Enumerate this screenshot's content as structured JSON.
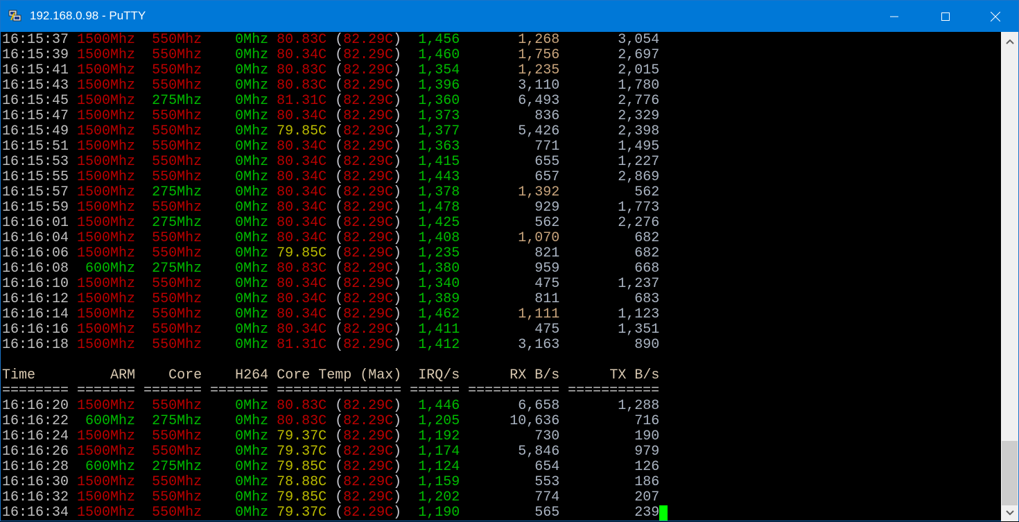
{
  "window": {
    "title": "192.168.0.98 - PuTTY"
  },
  "colors": {
    "titlebar": "#0078d7",
    "cursor": "#00ff00"
  },
  "header": [
    "Time",
    "ARM",
    "Core",
    "H264",
    "Core Temp (Max)",
    "IRQ/s",
    "RX B/s",
    "TX B/s"
  ],
  "separator": "======== ======= ======= ======= =============== ====== =========== ===========",
  "rows_top": [
    {
      "time": "16:15:37",
      "arm": "1500Mhz",
      "core": "550Mhz",
      "h264": "0Mhz",
      "temp": "80.83C",
      "max": "82.29C",
      "irq": "1,456",
      "rx": "1,268",
      "tx": "3,054"
    },
    {
      "time": "16:15:39",
      "arm": "1500Mhz",
      "core": "550Mhz",
      "h264": "0Mhz",
      "temp": "80.34C",
      "max": "82.29C",
      "irq": "1,460",
      "rx": "1,756",
      "tx": "2,697"
    },
    {
      "time": "16:15:41",
      "arm": "1500Mhz",
      "core": "550Mhz",
      "h264": "0Mhz",
      "temp": "80.83C",
      "max": "82.29C",
      "irq": "1,354",
      "rx": "1,235",
      "tx": "2,015"
    },
    {
      "time": "16:15:43",
      "arm": "1500Mhz",
      "core": "550Mhz",
      "h264": "0Mhz",
      "temp": "80.83C",
      "max": "82.29C",
      "irq": "1,396",
      "rx": "3,110",
      "tx": "1,780"
    },
    {
      "time": "16:15:45",
      "arm": "1500Mhz",
      "core": "275Mhz",
      "h264": "0Mhz",
      "temp": "81.31C",
      "max": "82.29C",
      "irq": "1,360",
      "rx": "6,493",
      "tx": "2,776"
    },
    {
      "time": "16:15:47",
      "arm": "1500Mhz",
      "core": "550Mhz",
      "h264": "0Mhz",
      "temp": "80.34C",
      "max": "82.29C",
      "irq": "1,373",
      "rx": "836",
      "tx": "2,329"
    },
    {
      "time": "16:15:49",
      "arm": "1500Mhz",
      "core": "550Mhz",
      "h264": "0Mhz",
      "temp": "79.85C",
      "max": "82.29C",
      "irq": "1,377",
      "rx": "5,426",
      "tx": "2,398"
    },
    {
      "time": "16:15:51",
      "arm": "1500Mhz",
      "core": "550Mhz",
      "h264": "0Mhz",
      "temp": "80.34C",
      "max": "82.29C",
      "irq": "1,363",
      "rx": "771",
      "tx": "1,495"
    },
    {
      "time": "16:15:53",
      "arm": "1500Mhz",
      "core": "550Mhz",
      "h264": "0Mhz",
      "temp": "80.34C",
      "max": "82.29C",
      "irq": "1,415",
      "rx": "655",
      "tx": "1,227"
    },
    {
      "time": "16:15:55",
      "arm": "1500Mhz",
      "core": "550Mhz",
      "h264": "0Mhz",
      "temp": "80.34C",
      "max": "82.29C",
      "irq": "1,443",
      "rx": "657",
      "tx": "2,869"
    },
    {
      "time": "16:15:57",
      "arm": "1500Mhz",
      "core": "275Mhz",
      "h264": "0Mhz",
      "temp": "80.34C",
      "max": "82.29C",
      "irq": "1,378",
      "rx": "1,392",
      "tx": "562"
    },
    {
      "time": "16:15:59",
      "arm": "1500Mhz",
      "core": "550Mhz",
      "h264": "0Mhz",
      "temp": "80.34C",
      "max": "82.29C",
      "irq": "1,478",
      "rx": "929",
      "tx": "1,773"
    },
    {
      "time": "16:16:01",
      "arm": "1500Mhz",
      "core": "275Mhz",
      "h264": "0Mhz",
      "temp": "80.34C",
      "max": "82.29C",
      "irq": "1,425",
      "rx": "562",
      "tx": "2,276"
    },
    {
      "time": "16:16:04",
      "arm": "1500Mhz",
      "core": "550Mhz",
      "h264": "0Mhz",
      "temp": "80.34C",
      "max": "82.29C",
      "irq": "1,408",
      "rx": "1,070",
      "tx": "682"
    },
    {
      "time": "16:16:06",
      "arm": "1500Mhz",
      "core": "550Mhz",
      "h264": "0Mhz",
      "temp": "79.85C",
      "max": "82.29C",
      "irq": "1,235",
      "rx": "821",
      "tx": "682"
    },
    {
      "time": "16:16:08",
      "arm": "600Mhz",
      "core": "275Mhz",
      "h264": "0Mhz",
      "temp": "80.83C",
      "max": "82.29C",
      "irq": "1,380",
      "rx": "959",
      "tx": "668"
    },
    {
      "time": "16:16:10",
      "arm": "1500Mhz",
      "core": "550Mhz",
      "h264": "0Mhz",
      "temp": "80.34C",
      "max": "82.29C",
      "irq": "1,340",
      "rx": "475",
      "tx": "1,237"
    },
    {
      "time": "16:16:12",
      "arm": "1500Mhz",
      "core": "550Mhz",
      "h264": "0Mhz",
      "temp": "80.34C",
      "max": "82.29C",
      "irq": "1,389",
      "rx": "811",
      "tx": "683"
    },
    {
      "time": "16:16:14",
      "arm": "1500Mhz",
      "core": "550Mhz",
      "h264": "0Mhz",
      "temp": "80.34C",
      "max": "82.29C",
      "irq": "1,462",
      "rx": "1,111",
      "tx": "1,123"
    },
    {
      "time": "16:16:16",
      "arm": "1500Mhz",
      "core": "550Mhz",
      "h264": "0Mhz",
      "temp": "80.34C",
      "max": "82.29C",
      "irq": "1,411",
      "rx": "475",
      "tx": "1,351"
    },
    {
      "time": "16:16:18",
      "arm": "1500Mhz",
      "core": "550Mhz",
      "h264": "0Mhz",
      "temp": "81.31C",
      "max": "82.29C",
      "irq": "1,412",
      "rx": "3,163",
      "tx": "890"
    }
  ],
  "rows_bottom": [
    {
      "time": "16:16:20",
      "arm": "1500Mhz",
      "core": "550Mhz",
      "h264": "0Mhz",
      "temp": "80.83C",
      "max": "82.29C",
      "irq": "1,446",
      "rx": "6,658",
      "tx": "1,288"
    },
    {
      "time": "16:16:22",
      "arm": "600Mhz",
      "core": "275Mhz",
      "h264": "0Mhz",
      "temp": "80.83C",
      "max": "82.29C",
      "irq": "1,205",
      "rx": "10,636",
      "tx": "716"
    },
    {
      "time": "16:16:24",
      "arm": "1500Mhz",
      "core": "550Mhz",
      "h264": "0Mhz",
      "temp": "79.37C",
      "max": "82.29C",
      "irq": "1,192",
      "rx": "730",
      "tx": "190"
    },
    {
      "time": "16:16:26",
      "arm": "1500Mhz",
      "core": "550Mhz",
      "h264": "0Mhz",
      "temp": "79.37C",
      "max": "82.29C",
      "irq": "1,174",
      "rx": "5,846",
      "tx": "979"
    },
    {
      "time": "16:16:28",
      "arm": "600Mhz",
      "core": "275Mhz",
      "h264": "0Mhz",
      "temp": "79.85C",
      "max": "82.29C",
      "irq": "1,124",
      "rx": "654",
      "tx": "126"
    },
    {
      "time": "16:16:30",
      "arm": "1500Mhz",
      "core": "550Mhz",
      "h264": "0Mhz",
      "temp": "78.88C",
      "max": "82.29C",
      "irq": "1,159",
      "rx": "553",
      "tx": "186"
    },
    {
      "time": "16:16:32",
      "arm": "1500Mhz",
      "core": "550Mhz",
      "h264": "0Mhz",
      "temp": "79.85C",
      "max": "82.29C",
      "irq": "1,202",
      "rx": "774",
      "tx": "207"
    },
    {
      "time": "16:16:34",
      "arm": "1500Mhz",
      "core": "550Mhz",
      "h264": "0Mhz",
      "temp": "79.37C",
      "max": "82.29C",
      "irq": "1,190",
      "rx": "565",
      "tx": "239"
    }
  ]
}
